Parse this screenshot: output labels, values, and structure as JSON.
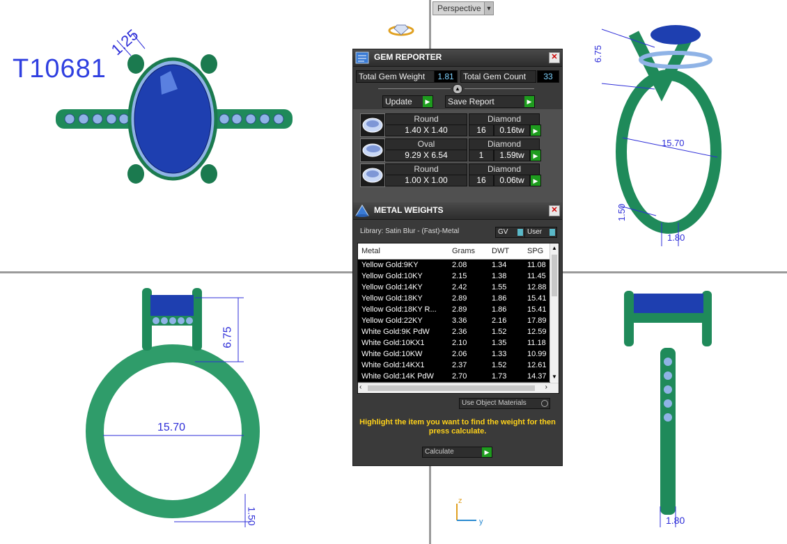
{
  "viewport": {
    "perspective_label": "Perspective",
    "model_code": "T10681",
    "dims": {
      "top_prong": "1.25",
      "side_height": "6.75",
      "side_diameter": "15.70",
      "side_shank": "1.50",
      "side_width": "1.80",
      "front_height": "6.75",
      "front_diameter": "15.70",
      "front_shank": "1.50",
      "end_width": "1.80"
    },
    "axis_z": "z",
    "axis_y": "y"
  },
  "gem_reporter": {
    "title": "GEM REPORTER",
    "total_weight_label": "Total Gem Weight",
    "total_weight_value": "1.81",
    "total_count_label": "Total Gem Count",
    "total_count_value": "33",
    "update_label": "Update",
    "save_label": "Save Report",
    "gems": [
      {
        "shape": "Round",
        "type": "Diamond",
        "size": "1.40 X 1.40",
        "count": "16",
        "weight": "0.16tw"
      },
      {
        "shape": "Oval",
        "type": "Diamond",
        "size": "9.29 X 6.54",
        "count": "1",
        "weight": "1.59tw"
      },
      {
        "shape": "Round",
        "type": "Diamond",
        "size": "1.00 X 1.00",
        "count": "16",
        "weight": "0.06tw"
      }
    ]
  },
  "metal_weights": {
    "title": "METAL WEIGHTS",
    "library": "Library: Satin Blur - (Fast)-Metal",
    "gv_label": "GV",
    "user_label": "User",
    "columns": [
      "Metal",
      "Grams",
      "DWT",
      "SPG"
    ],
    "rows": [
      [
        "Yellow Gold:9KY",
        "2.08",
        "1.34",
        "11.08"
      ],
      [
        "Yellow Gold:10KY",
        "2.15",
        "1.38",
        "11.45"
      ],
      [
        "Yellow Gold:14KY",
        "2.42",
        "1.55",
        "12.88"
      ],
      [
        "Yellow Gold:18KY",
        "2.89",
        "1.86",
        "15.41"
      ],
      [
        "Yellow Gold:18KY R...",
        "2.89",
        "1.86",
        "15.41"
      ],
      [
        "Yellow Gold:22KY",
        "3.36",
        "2.16",
        "17.89"
      ],
      [
        "White Gold:9K PdW",
        "2.36",
        "1.52",
        "12.59"
      ],
      [
        "White Gold:10KX1",
        "2.10",
        "1.35",
        "11.18"
      ],
      [
        "White Gold:10KW",
        "2.06",
        "1.33",
        "10.99"
      ],
      [
        "White Gold:14KX1",
        "2.37",
        "1.52",
        "12.61"
      ],
      [
        "White Gold:14K PdW",
        "2.70",
        "1.73",
        "14.37"
      ]
    ],
    "use_object_materials": "Use Object Materials",
    "note": "Highlight the item you want to find the weight for then press calculate.",
    "calculate_label": "Calculate"
  },
  "colors": {
    "ring_green": "#1f8a5a",
    "gem_blue": "#1e3fb0",
    "dim_blue": "#2e2ed8",
    "note_yellow": "#ffd21a"
  }
}
